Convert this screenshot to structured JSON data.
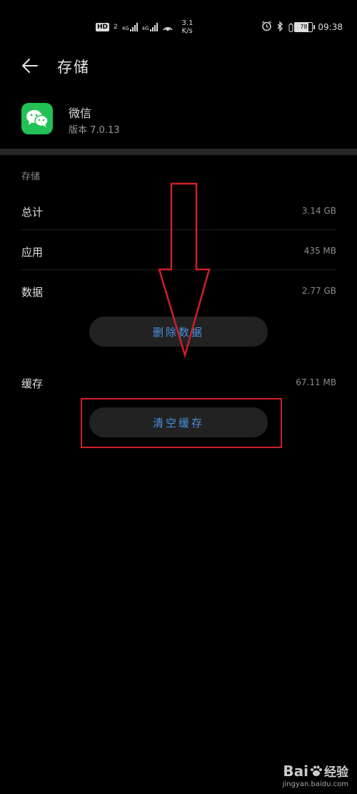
{
  "status_bar": {
    "hd_label": "HD",
    "hd_sub": "2",
    "sim1_tag": "4G",
    "sim2_tag": "4G",
    "speed_value": "3.1",
    "speed_unit": "K/s",
    "battery_level": "78",
    "time": "09:38"
  },
  "header": {
    "title": "存储"
  },
  "app": {
    "name": "微信",
    "version": "版本 7.0.13"
  },
  "storage": {
    "section_title": "存储",
    "rows": [
      {
        "label": "总计",
        "value": "3.14 GB"
      },
      {
        "label": "应用",
        "value": "435 MB"
      },
      {
        "label": "数据",
        "value": "2.77 GB"
      }
    ],
    "delete_data_label": "删除数据",
    "cache_label": "缓存",
    "cache_value": "67.11 MB",
    "clear_cache_label": "清空缓存"
  },
  "watermark": {
    "brand_left": "Bai",
    "brand_right": "经验",
    "url": "jingyan.baidu.com"
  },
  "colors": {
    "accent_blue": "#4a90e2",
    "highlight_red": "#d01f2a",
    "wechat_green": "#21c156"
  }
}
